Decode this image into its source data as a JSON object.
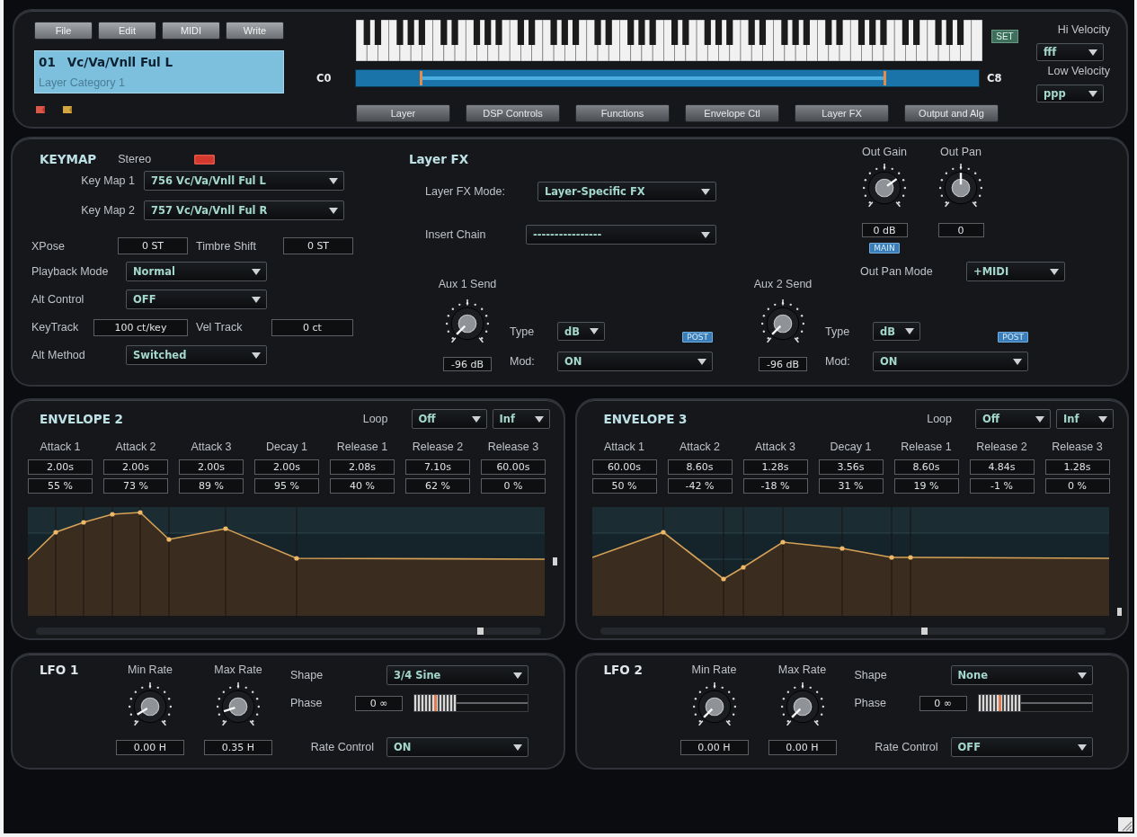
{
  "toolbar": {
    "buttons": [
      "File",
      "Edit",
      "MIDI",
      "Write"
    ]
  },
  "preset": {
    "number": "01",
    "name": "Vc/Va/Vnll Ful L",
    "category": "Layer Category 1"
  },
  "keyboard": {
    "set_button": "SET",
    "low_label": "C0",
    "high_label": "C8",
    "range_handles": [
      {
        "level": 0.104
      },
      {
        "level": 0.849
      }
    ]
  },
  "page_buttons": [
    "Layer",
    "DSP Controls",
    "Functions",
    "Envelope Ctl",
    "Layer FX",
    "Output and Alg"
  ],
  "velocity": [
    {
      "label": "Hi Velocity",
      "value": "fff"
    },
    {
      "label": "Low Velocity",
      "value": "ppp"
    }
  ],
  "keymap": {
    "title": "KEYMAP",
    "stereo": {
      "label": "Stereo",
      "on": true
    },
    "maps": [
      {
        "label": "Key Map 1",
        "value": "756 Vc/Va/Vnll Ful L"
      },
      {
        "label": "Key Map 2",
        "value": "757 Vc/Va/Vnll Ful R"
      }
    ],
    "xpose": {
      "label": "XPose",
      "value": "0 ST"
    },
    "timbre_shift": {
      "label": "Timbre Shift",
      "value": "0 ST"
    },
    "playback_mode": {
      "label": "Playback Mode",
      "value": "Normal"
    },
    "alt_control": {
      "label": "Alt Control",
      "value": "OFF"
    },
    "keytrack": {
      "label": "KeyTrack",
      "value": "100 ct/key"
    },
    "vel_track": {
      "label": "Vel Track",
      "value": "0 ct"
    },
    "alt_method": {
      "label": "Alt Method",
      "value": "Switched"
    }
  },
  "layer_fx": {
    "title": "Layer FX",
    "mode": {
      "label": "Layer FX Mode:",
      "value": "Layer-Specific FX"
    },
    "insert_chain": {
      "label": "Insert Chain",
      "value": "----------------"
    },
    "aux_sends": [
      {
        "label": "Aux 1 Send",
        "level": 0,
        "value": "-96 dB",
        "type_label": "Type",
        "type": "dB",
        "badge": "POST",
        "mod_label": "Mod:",
        "mod": "ON"
      },
      {
        "label": "Aux 2 Send",
        "level": 0,
        "value": "-96 dB",
        "type_label": "Type",
        "type": "dB",
        "badge": "POST",
        "mod_label": "Mod:",
        "mod": "ON"
      }
    ]
  },
  "output": {
    "gain": {
      "label": "Out Gain",
      "level": 0.7,
      "value": "0 dB",
      "badge": "MAIN"
    },
    "pan": {
      "label": "Out Pan",
      "level": 0.5,
      "value": "0"
    },
    "pan_mode": {
      "label": "Out Pan Mode",
      "value": "+MIDI"
    }
  },
  "envelopes": [
    {
      "title": "ENVELOPE 2",
      "loop_label": "Loop",
      "loop": "Off",
      "loop_count": "Inf",
      "stages": [
        {
          "label": "Attack 1",
          "time": "2.00s",
          "amount": "55 %"
        },
        {
          "label": "Attack 2",
          "time": "2.00s",
          "amount": "73 %"
        },
        {
          "label": "Attack 3",
          "time": "2.00s",
          "amount": "89 %"
        },
        {
          "label": "Decay 1",
          "time": "2.00s",
          "amount": "95 %"
        },
        {
          "label": "Release 1",
          "time": "2.08s",
          "amount": "40 %"
        },
        {
          "label": "Release 2",
          "time": "7.10s",
          "amount": "62 %"
        },
        {
          "label": "Release 3",
          "time": "60.00s",
          "amount": "0 %"
        }
      ]
    },
    {
      "title": "ENVELOPE 3",
      "loop_label": "Loop",
      "loop": "Off",
      "loop_count": "Inf",
      "stages": [
        {
          "label": "Attack 1",
          "time": "60.00s",
          "amount": "50 %"
        },
        {
          "label": "Attack 2",
          "time": "8.60s",
          "amount": "-42 %"
        },
        {
          "label": "Attack 3",
          "time": "1.28s",
          "amount": "-18 %"
        },
        {
          "label": "Decay 1",
          "time": "3.56s",
          "amount": "31 %"
        },
        {
          "label": "Release 1",
          "time": "8.60s",
          "amount": "19 %"
        },
        {
          "label": "Release 2",
          "time": "4.84s",
          "amount": "-1 %"
        },
        {
          "label": "Release 3",
          "time": "1.28s",
          "amount": "0 %"
        }
      ]
    }
  ],
  "lfos": [
    {
      "title": "LFO 1",
      "min_rate": {
        "label": "Min Rate",
        "level": 0.05,
        "value": "0.00 H"
      },
      "max_rate": {
        "label": "Max Rate",
        "level": 0.1,
        "value": "0.35 H"
      },
      "shape": {
        "label": "Shape",
        "value": "3/4 Sine"
      },
      "phase": {
        "label": "Phase",
        "value": "0 ∞",
        "level": 0
      },
      "rate_control": {
        "label": "Rate Control",
        "value": "ON"
      }
    },
    {
      "title": "LFO 2",
      "min_rate": {
        "label": "Min Rate",
        "level": 0,
        "value": "0.00 H"
      },
      "max_rate": {
        "label": "Max Rate",
        "level": 0,
        "value": "0.00 H"
      },
      "shape": {
        "label": "Shape",
        "value": "None"
      },
      "phase": {
        "label": "Phase",
        "value": "0 ∞",
        "level": 0
      },
      "rate_control": {
        "label": "Rate Control",
        "value": "OFF"
      }
    }
  ]
}
